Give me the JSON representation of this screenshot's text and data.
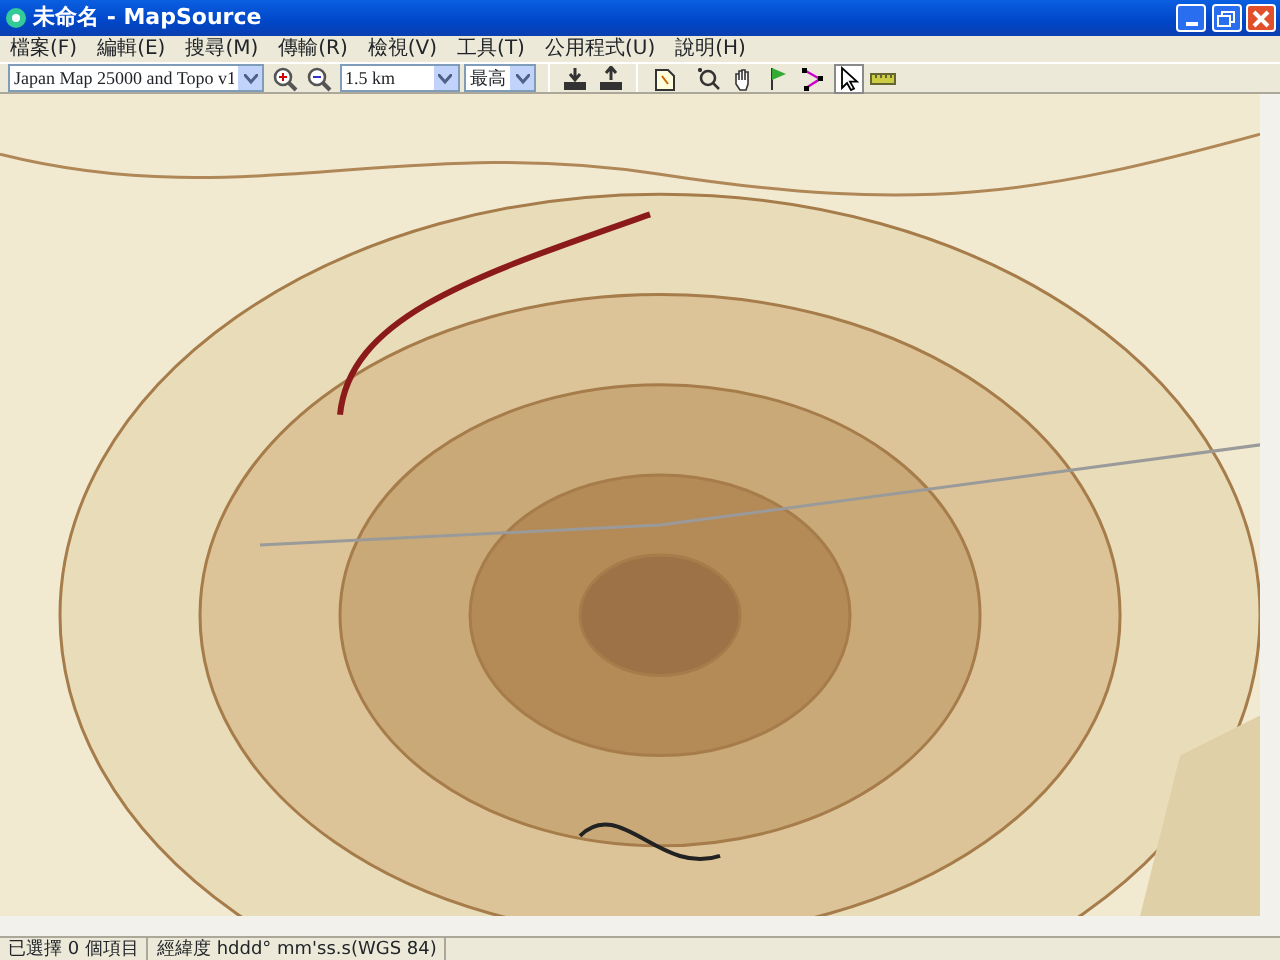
{
  "window": {
    "title": "未命名 - MapSource"
  },
  "menu": [
    "檔案(F)",
    "編輯(E)",
    "搜尋(M)",
    "傳輸(R)",
    "檢視(V)",
    "工具(T)",
    "公用程式(U)",
    "說明(H)"
  ],
  "toolbar": {
    "map_product": "Japan Map 25000 and Topo v1",
    "scale": "1.5 km",
    "detail": "最高",
    "tools": [
      {
        "kind": "map",
        "selected": false
      },
      {
        "kind": "zoom",
        "selected": false
      },
      {
        "kind": "hand",
        "selected": false
      },
      {
        "kind": "waypoint",
        "selected": false
      },
      {
        "kind": "route",
        "selected": false
      },
      {
        "kind": "pointer",
        "selected": true
      },
      {
        "kind": "measure",
        "selected": false
      }
    ]
  },
  "status_bar": [
    "已選擇 0 個項目",
    "經緯度 hddd° mm'ss.s(WGS 84)"
  ]
}
